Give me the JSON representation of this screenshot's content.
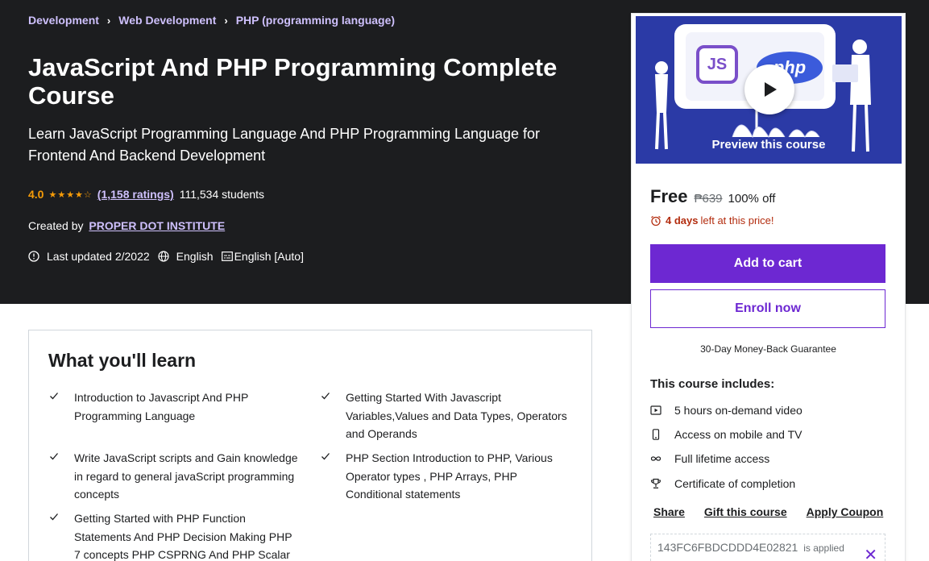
{
  "breadcrumb": {
    "items": [
      "Development",
      "Web Development",
      "PHP (programming language)"
    ],
    "separator": "›"
  },
  "course": {
    "title": "JavaScript And PHP Programming Complete Course",
    "subtitle": "Learn JavaScript Programming Language And PHP Programming Language for Frontend And Backend Development",
    "rating": "4.0",
    "stars": "★★★★☆",
    "rating_fraction": 0.8,
    "ratings_count": "(1,158 ratings)",
    "students": "111,534 students",
    "created_by_label": "Created by",
    "instructor": "PROPER DOT INSTITUTE",
    "last_updated": "Last updated 2/2022",
    "language": "English",
    "captions": "English [Auto]"
  },
  "learn": {
    "title": "What you'll learn",
    "items": [
      "Introduction to Javascript And PHP Programming Language",
      "Getting Started With Javascript Variables,Values and Data Types, Operators and Operands",
      "Write JavaScript scripts and Gain knowledge in regard to general javaScript programming concepts",
      "PHP Section Introduction to PHP, Various Operator types , PHP Arrays, PHP Conditional statements",
      "Getting Started with PHP Function Statements And PHP Decision Making PHP 7 concepts PHP CSPRNG And PHP Scalar"
    ]
  },
  "sidebar": {
    "preview_label": "Preview this course",
    "preview_logos": [
      "JS",
      "php"
    ],
    "price": "Free",
    "original_price": "₱639",
    "discount": "100% off",
    "timer_bold": "4 days",
    "timer_rest": "left at this price!",
    "add_to_cart": "Add to cart",
    "enroll": "Enroll now",
    "guarantee": "30-Day Money-Back Guarantee",
    "includes_title": "This course includes:",
    "includes": [
      {
        "icon": "video-icon",
        "label": "5 hours on-demand video"
      },
      {
        "icon": "mobile-icon",
        "label": "Access on mobile and TV"
      },
      {
        "icon": "infinity-icon",
        "label": "Full lifetime access"
      },
      {
        "icon": "trophy-icon",
        "label": "Certificate of completion"
      }
    ],
    "share": "Share",
    "gift": "Gift this course",
    "coupon": "Apply Coupon",
    "coupon_code": "143FC6FBDCDDD4E02821",
    "coupon_applied": "is applied"
  },
  "colors": {
    "hero_bg": "#1c1d1f",
    "accent_purple": "#6d28d2",
    "link_lavender": "#cec0fc",
    "star_orange": "#f69c08",
    "timer_red": "#b32d0f"
  }
}
